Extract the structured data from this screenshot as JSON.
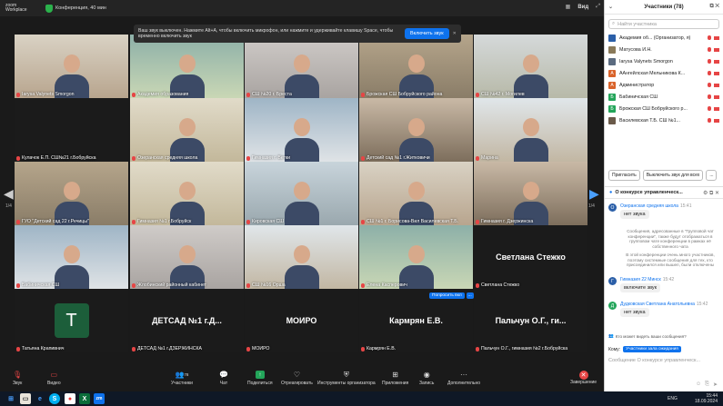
{
  "titlebar": {
    "logo_line1": "zoom",
    "logo_line2": "Workplace",
    "meeting": "Конференция, 40 мин",
    "view": "Вид"
  },
  "banner": {
    "text": "Ваш звук выключен. Нажмите Alt+A, чтобы включить микрофон, или нажмите и удерживайте клавишу Space, чтобы временно включить звук",
    "button": "Включить звук"
  },
  "gallery": {
    "page_left": "1/4",
    "page_right": "1/4",
    "tiles": [
      {
        "name": "Iarysa Valynets Smorgon",
        "type": "video",
        "scene": "s1"
      },
      {
        "name": "Академия образования",
        "type": "video",
        "scene": "s2"
      },
      {
        "name": "СШ №20 г. Бреста",
        "type": "video",
        "scene": "s3"
      },
      {
        "name": "Брожская СШ Бобруйского района",
        "type": "video",
        "scene": "s4"
      },
      {
        "name": "СШ №42 г. Могилев",
        "type": "video",
        "scene": "s5"
      },
      {
        "name": "Кулачок Е.П. СШ№21 г.Бобруйска",
        "type": "dark"
      },
      {
        "name": "Озеранская средняя школа",
        "type": "video",
        "scene": "s6"
      },
      {
        "name": "Гимназия г. Ветки",
        "type": "video",
        "scene": "s7"
      },
      {
        "name": "Детский сад №1 г.Житковичи",
        "type": "video",
        "scene": "s8"
      },
      {
        "name": "Марина",
        "type": "video",
        "scene": "s10"
      },
      {
        "name": "ГУО \"Детский сад 22 г.Речицы\"",
        "type": "video",
        "scene": "s4"
      },
      {
        "name": "Гимназия №1 г.Бобруйск",
        "type": "video",
        "scene": "s6"
      },
      {
        "name": "Кировская СШ",
        "type": "video",
        "scene": "s9"
      },
      {
        "name": "СШ №1 г. Борисова-Вил Василевская Т.Б.",
        "type": "video",
        "scene": "s1"
      },
      {
        "name": "Гимназия г. Дзержинска",
        "type": "video",
        "scene": "s8"
      },
      {
        "name": "Бабиничская СШ",
        "type": "video",
        "scene": "s7"
      },
      {
        "name": "Жлобинский районный кабинет",
        "type": "video",
        "scene": "s3"
      },
      {
        "name": "СШ №16 Орша",
        "type": "video",
        "scene": "s10"
      },
      {
        "name": "Елена Касперович",
        "type": "video",
        "scene": "s2"
      },
      {
        "name": "Светлана Стежко",
        "type": "text",
        "big": "Светлана Стежко"
      },
      {
        "name": "Татьяна Крапивнич",
        "type": "avatar",
        "big": "T"
      },
      {
        "name": "ДЕТСАД №1 г.ДЗЕРЖИНСКА",
        "type": "text",
        "big": "ДЕТСАД №1 г.Д..."
      },
      {
        "name": "МОИРО",
        "type": "text",
        "big": "МОИРО"
      },
      {
        "name": "Кармрян Е.В.",
        "type": "text",
        "big": "Кармрян Е.В."
      },
      {
        "name": "Пальчун О.Г., гимназия №2 г.Бобруйска",
        "type": "text",
        "big": "Пальчун О.Г., ги..."
      }
    ],
    "tile_menu_label": "Попросить вкл",
    "tile_menu_more": "..."
  },
  "toolbar": {
    "audio": "Звук",
    "video": "Видео",
    "participants": "Участники",
    "participants_count": "78",
    "chat": "Чат",
    "share": "Поделиться",
    "react": "Отреагировать",
    "host_tools": "Инструменты организатора",
    "apps": "Приложения",
    "record": "Запись",
    "more": "Дополнительно",
    "end": "Завершение"
  },
  "panel": {
    "title": "Участники (78)",
    "search_placeholder": "Найти участника",
    "participants": [
      {
        "initial": "",
        "name": "Академия об... (Организатор, я)",
        "color": "#2b5fa8"
      },
      {
        "initial": "",
        "name": "Матусова И.Н.",
        "color": "#8a7a5a"
      },
      {
        "initial": "",
        "name": "Iarysa Valynets Smorgon",
        "color": "#5b6b80"
      },
      {
        "initial": "А",
        "name": "AАнгейлская Мельникова К...",
        "color": "#d9632b"
      },
      {
        "initial": "А",
        "name": "Администратор",
        "color": "#d9632b"
      },
      {
        "initial": "Б",
        "name": "Бабиничская СШ",
        "color": "#23a55a"
      },
      {
        "initial": "Б",
        "name": "Брожская СШ Бобруйского р...",
        "color": "#23a55a"
      },
      {
        "initial": "",
        "name": "Василевская Т.Б. СШ №1...",
        "color": "#6a5a4a"
      }
    ],
    "invite": "Пригласить",
    "mute_all": "Выключить звук для всех",
    "more": "...",
    "chat_title": "О конкурсе управленческ...",
    "messages": [
      {
        "sender": "Озеранская средняя школа",
        "time": "15:41",
        "text": "нет звука",
        "initial": "O",
        "color": "#2b5fa8"
      },
      {
        "sender": "Гимназия 22 Минск",
        "time": "15:42",
        "text": "включите звук",
        "initial": "Г",
        "color": "#2b5fa8"
      },
      {
        "sender": "Дудковская Светлана Анатольевна",
        "time": "15:42",
        "text": "нет звука",
        "initial": "Д",
        "color": "#23a55a"
      }
    ],
    "sys1": "Сообщения, адресованные в \"Групповой чат конференции\", также будут отображаться в групповом чате конференции в рамках её собственного чата",
    "sys2": "В этой конференции очень много участников, поэтому системные сообщения для тех, кто присоединился или вышел, были отключены",
    "who_can_see": "Кто может видеть ваши сообщения?",
    "to_label": "Кому:",
    "to_value": "Участники зала ожидания",
    "input_placeholder": "Сообщение О конкурсе управленческ..."
  },
  "taskbar": {
    "lang": "ENG",
    "time": "15:44",
    "date": "18.09.2024"
  }
}
